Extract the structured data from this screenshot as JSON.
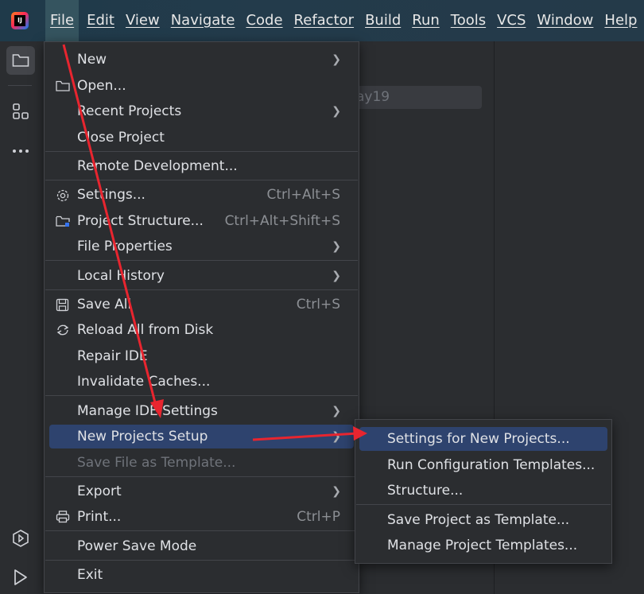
{
  "app": {
    "logo_text": "IJ"
  },
  "menubar": {
    "items": [
      "File",
      "Edit",
      "View",
      "Navigate",
      "Code",
      "Refactor",
      "Build",
      "Run",
      "Tools",
      "VCS",
      "Window",
      "Help"
    ],
    "active": "File"
  },
  "background": {
    "search_value": "ay19"
  },
  "file_menu": {
    "new": "New",
    "open": "Open...",
    "recent_projects": "Recent Projects",
    "close_project": "Close Project",
    "remote_development": "Remote Development...",
    "settings": "Settings...",
    "settings_shortcut": "Ctrl+Alt+S",
    "project_structure": "Project Structure...",
    "project_structure_shortcut": "Ctrl+Alt+Shift+S",
    "file_properties": "File Properties",
    "local_history": "Local History",
    "save_all": "Save All",
    "save_all_shortcut": "Ctrl+S",
    "reload_all": "Reload All from Disk",
    "repair_ide": "Repair IDE",
    "invalidate_caches": "Invalidate Caches...",
    "manage_ide_settings": "Manage IDE Settings",
    "new_projects_setup": "New Projects Setup",
    "save_file_as_template": "Save File as Template...",
    "export": "Export",
    "print": "Print...",
    "print_shortcut": "Ctrl+P",
    "power_save_mode": "Power Save Mode",
    "exit": "Exit"
  },
  "submenu": {
    "settings_for_new_projects": "Settings for New Projects...",
    "run_configuration_templates": "Run Configuration Templates...",
    "structure": "Structure...",
    "save_project_as_template": "Save Project as Template...",
    "manage_project_templates": "Manage Project Templates..."
  },
  "colors": {
    "highlight": "#2e436e",
    "annotation_arrow": "#e8252f",
    "titlebar": "#243a49"
  },
  "annotations": {
    "arrow_count": 2
  }
}
